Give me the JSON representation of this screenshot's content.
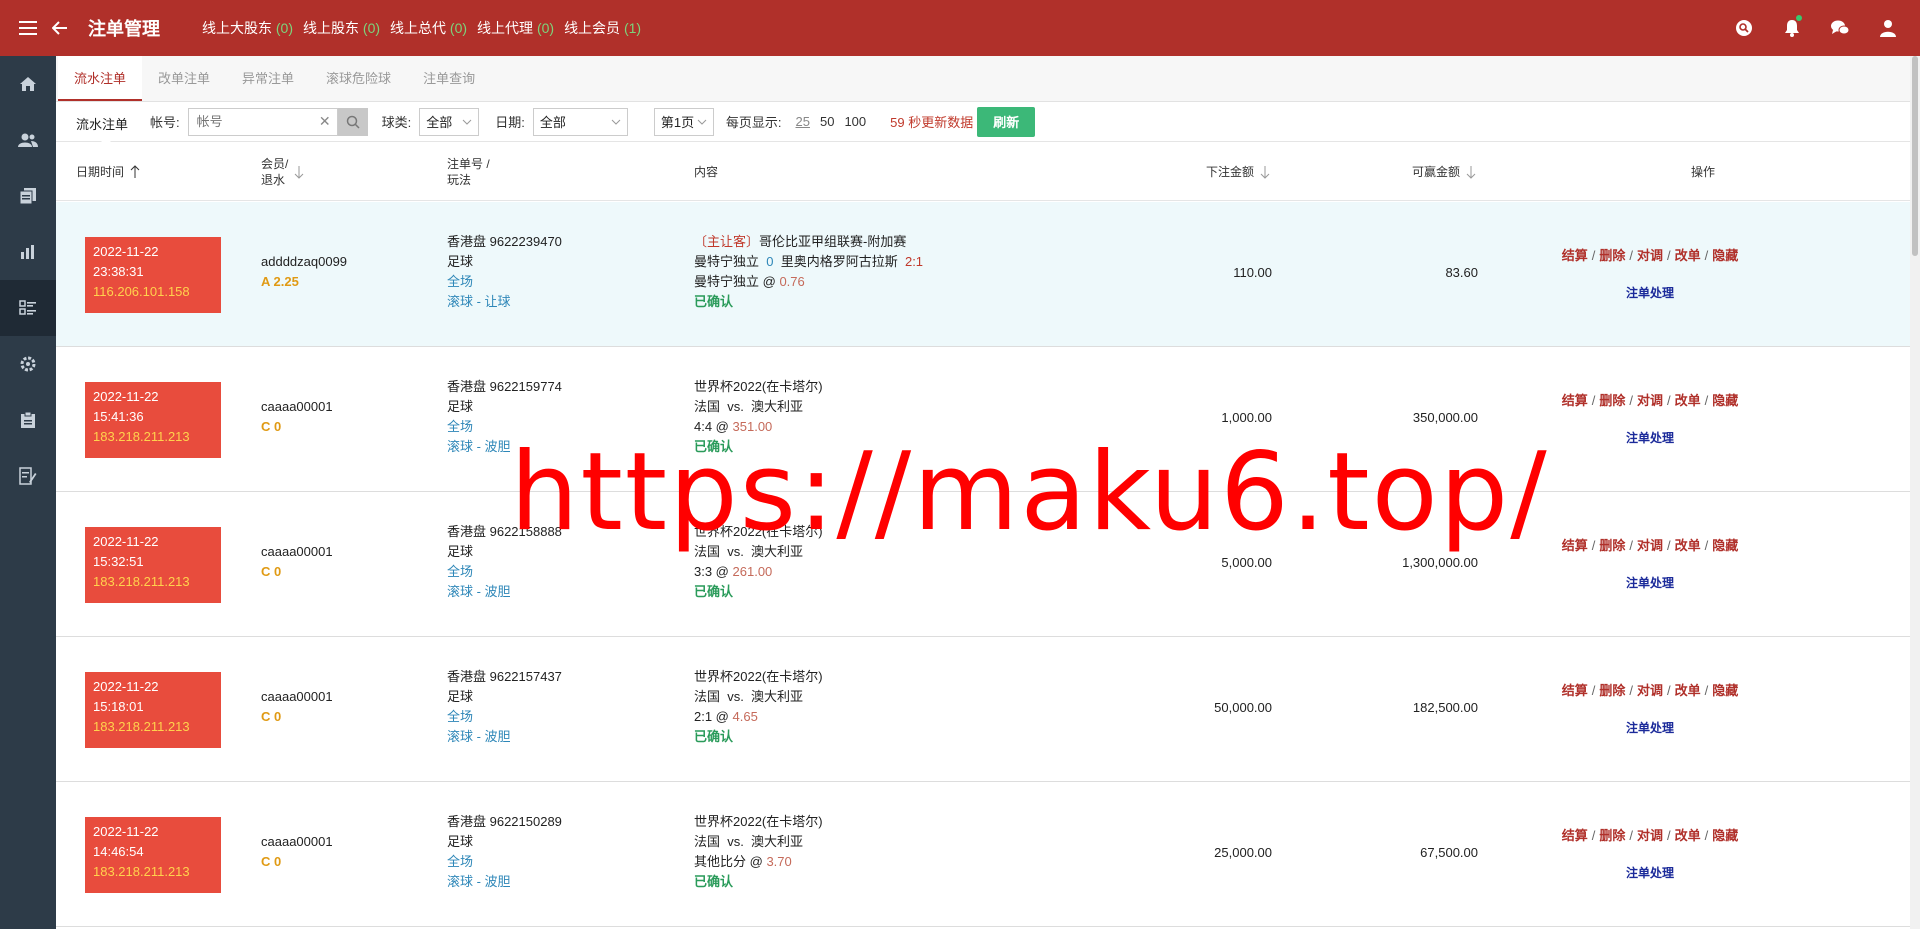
{
  "header": {
    "title": "注单管理",
    "stats": [
      {
        "label": "线上大股东",
        "count": "(0)"
      },
      {
        "label": "线上股东",
        "count": "(0)"
      },
      {
        "label": "线上总代",
        "count": "(0)"
      },
      {
        "label": "线上代理",
        "count": "(0)"
      },
      {
        "label": "线上会员",
        "count": "(1)"
      }
    ]
  },
  "tabs": [
    "流水注单",
    "改单注单",
    "异常注单",
    "滚球危险球",
    "注单查询"
  ],
  "filter": {
    "subtab": "流水注单",
    "account_label": "帐号:",
    "account_placeholder": "帐号",
    "ball_label": "球类:",
    "ball_value": "全部",
    "date_label": "日期:",
    "date_value": "全部",
    "page_value": "第1页",
    "per_page_label": "每页显示:",
    "per_page_options": [
      "25",
      "50",
      "100"
    ],
    "update_seconds": "59",
    "update_text": "秒更新数据",
    "refresh_label": "刷新"
  },
  "columns": {
    "datetime": "日期时间",
    "member_1": "会员/",
    "member_2": "退水",
    "bet_1": "注单号 /",
    "bet_2": "玩法",
    "content": "内容",
    "stake": "下注金额",
    "win": "可赢金额",
    "action": "操作"
  },
  "actions": {
    "settle": "结算",
    "delete": "删除",
    "adjust": "对调",
    "modify": "改单",
    "hide": "隐藏",
    "process": "注单处理"
  },
  "rows": [
    {
      "date": "2022-11-22",
      "time": "23:38:31",
      "ip": "116.206.101.158",
      "member": "addddzaq0099",
      "code": "A 2.25",
      "bet_no": "香港盘 9622239470",
      "sport": "足球",
      "period": "全场",
      "type": "滚球 - 让球",
      "tag": "〔主让客〕",
      "league": "哥伦比亚甲组联赛-附加赛",
      "home": "曼特宁独立",
      "hcap": "0",
      "away": "里奥内格罗阿古拉斯",
      "score": "2:1",
      "pick": "曼特宁独立 @",
      "odds": "0.76",
      "status": "已确认",
      "stake": "110.00",
      "win": "83.60"
    },
    {
      "date": "2022-11-22",
      "time": "15:41:36",
      "ip": "183.218.211.213",
      "member": "caaaa00001",
      "code": "C 0",
      "bet_no": "香港盘 9622159774",
      "sport": "足球",
      "period": "全场",
      "type": "滚球 - 波胆",
      "league": "世界杯2022(在卡塔尔)",
      "match": "法国  vs.  澳大利亚",
      "pick": "4:4 @",
      "odds": "351.00",
      "status": "已确认",
      "stake": "1,000.00",
      "win": "350,000.00"
    },
    {
      "date": "2022-11-22",
      "time": "15:32:51",
      "ip": "183.218.211.213",
      "member": "caaaa00001",
      "code": "C 0",
      "bet_no": "香港盘 9622158888",
      "sport": "足球",
      "period": "全场",
      "type": "滚球 - 波胆",
      "league": "世界杯2022(在卡塔尔)",
      "match": "法国  vs.  澳大利亚",
      "pick": "3:3 @",
      "odds": "261.00",
      "status": "已确认",
      "stake": "5,000.00",
      "win": "1,300,000.00"
    },
    {
      "date": "2022-11-22",
      "time": "15:18:01",
      "ip": "183.218.211.213",
      "member": "caaaa00001",
      "code": "C 0",
      "bet_no": "香港盘 9622157437",
      "sport": "足球",
      "period": "全场",
      "type": "滚球 - 波胆",
      "league": "世界杯2022(在卡塔尔)",
      "match": "法国  vs.  澳大利亚",
      "pick": "2:1 @",
      "odds": "4.65",
      "status": "已确认",
      "stake": "50,000.00",
      "win": "182,500.00"
    },
    {
      "date": "2022-11-22",
      "time": "14:46:54",
      "ip": "183.218.211.213",
      "member": "caaaa00001",
      "code": "C 0",
      "bet_no": "香港盘 9622150289",
      "sport": "足球",
      "period": "全场",
      "type": "滚球 - 波胆",
      "league": "世界杯2022(在卡塔尔)",
      "match": "法国  vs.  澳大利亚",
      "pick": "其他比分 @",
      "odds": "3.70",
      "status": "已确认",
      "stake": "25,000.00",
      "win": "67,500.00"
    }
  ],
  "watermark": "https://maku6.top/",
  "colors": {
    "header": "#b0302a",
    "sidebar": "#2d3b48",
    "timestamp_box": "#e84c3d",
    "refresh": "#3cb878"
  }
}
